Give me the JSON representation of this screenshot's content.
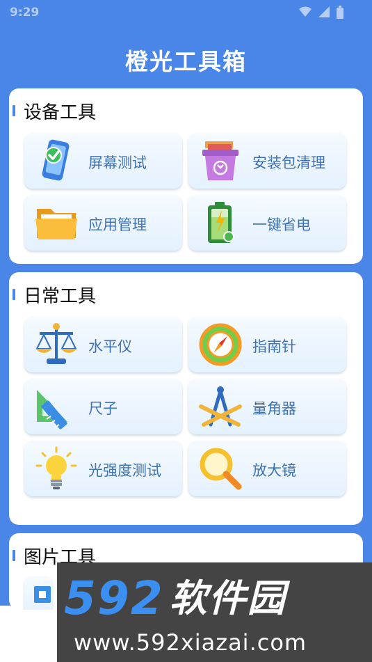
{
  "status_bar": {
    "time": "9:29"
  },
  "app_title": "橙光工具箱",
  "sections": [
    {
      "title": "设备工具",
      "tools": [
        {
          "label": "屏幕测试",
          "icon": "phone-check-icon"
        },
        {
          "label": "安装包清理",
          "icon": "recycle-bin-icon"
        },
        {
          "label": "应用管理",
          "icon": "folder-icon"
        },
        {
          "label": "一键省电",
          "icon": "battery-icon"
        }
      ]
    },
    {
      "title": "日常工具",
      "tools": [
        {
          "label": "水平仪",
          "icon": "balance-scale-icon"
        },
        {
          "label": "指南针",
          "icon": "compass-icon"
        },
        {
          "label": "尺子",
          "icon": "ruler-icon"
        },
        {
          "label": "量角器",
          "icon": "drafting-compass-icon"
        },
        {
          "label": "光强度测试",
          "icon": "light-bulb-icon"
        },
        {
          "label": "放大镜",
          "icon": "magnifier-icon"
        }
      ]
    },
    {
      "title": "图片工具",
      "tools": []
    }
  ],
  "watermark": {
    "numbers": "592",
    "brand": "软件园",
    "url": "www.592xiazai.com"
  },
  "colors": {
    "primary": "#4a86e8",
    "tile_text": "#3e72b4",
    "tile_bg": "#e8f3ff"
  }
}
